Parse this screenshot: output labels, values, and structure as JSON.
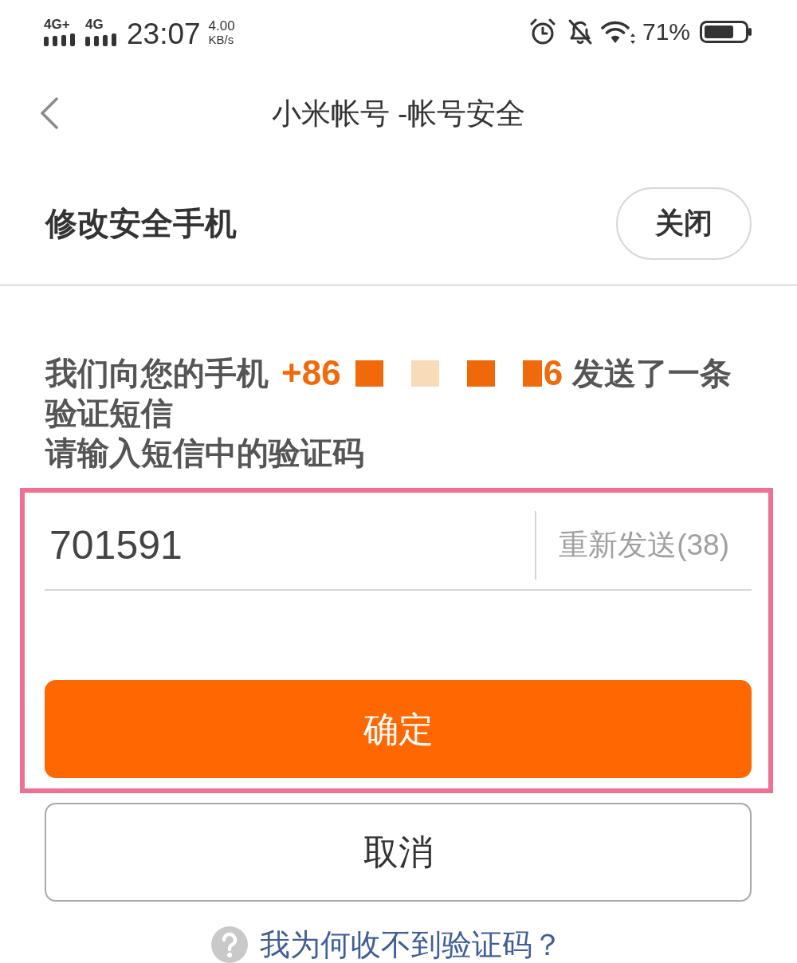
{
  "status_bar": {
    "networks": [
      {
        "label": "4G+"
      },
      {
        "label": "4G"
      }
    ],
    "time": "23:07",
    "speed": {
      "value": "4.00",
      "unit": "KB/s"
    },
    "battery": "71%"
  },
  "header": {
    "title": "小米帐号 -帐号安全"
  },
  "section": {
    "title": "修改安全手机",
    "close_button": "关闭"
  },
  "message": {
    "lead": "我们向您的手机",
    "phone_head": "+86",
    "redactions": [
      {
        "color": "#f06a0b"
      },
      {
        "color": "#f8dcb9"
      },
      {
        "color": "#ef690b"
      },
      {
        "color": "#f06a0b"
      }
    ],
    "phone_tail": "6",
    "tail": "发送了一条",
    "second_line": "验证短信"
  },
  "instruction": "请输入短信中的验证码",
  "code_field": {
    "value": "701591"
  },
  "resend": {
    "label": "重新发送(38)",
    "disabled": true
  },
  "confirm_button": "确定",
  "cancel_button": "取消",
  "help_link": "我为何收不到验证码？"
}
